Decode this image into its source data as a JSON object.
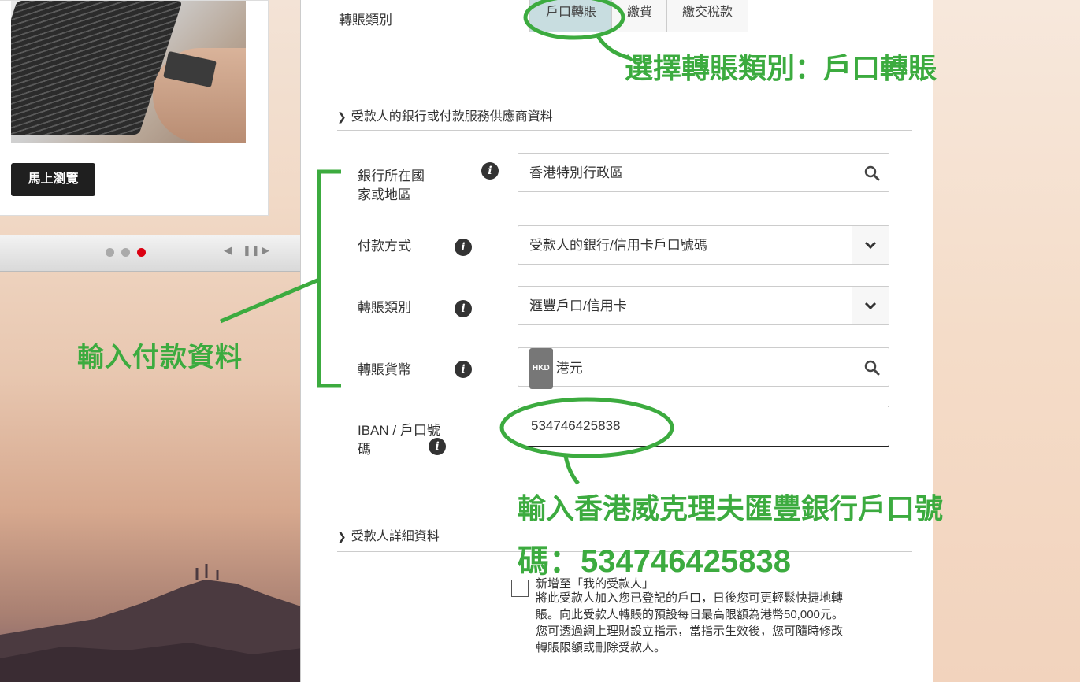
{
  "promo": {
    "browse_button": "馬上瀏覽",
    "carousel_controls": "◀ ⏸ ▶"
  },
  "transfer_type_row": {
    "label": "轉賬類別",
    "tabs": [
      "戶口轉賬",
      "繳費",
      "繳交稅款"
    ],
    "active_tab": "戶口轉賬"
  },
  "bank_section": {
    "header": "受款人的銀行或付款服務供應商資料",
    "fields": {
      "country": {
        "label": "銀行所在國家或地區",
        "label_line1": "銀行所在國",
        "label_line2": "家或地區",
        "value": "香港特別行政區"
      },
      "payment_method": {
        "label": "付款方式",
        "value": "受款人的銀行/信用卡戶口號碼"
      },
      "transfer_type": {
        "label": "轉賬類別",
        "value": "滙豐戶口/信用卡"
      },
      "currency": {
        "label": "轉賬貨幣",
        "badge": "HKD",
        "value": "港元"
      },
      "account": {
        "label": "IBAN / 戶口號碼",
        "label_line1": "IBAN / 戶口號",
        "label_line2": "碼",
        "value": "534746425838"
      }
    }
  },
  "payee_section": {
    "header": "受款人詳細資料",
    "add_to_payees": {
      "title": "新增至「我的受款人」",
      "description": "將此受款人加入您已登記的戶口，日後您可更輕鬆快捷地轉賬。向此受款人轉賬的預設每日最高限額為港幣50,000元。您可透過網上理財設立指示，當指示生效後，您可隨時修改轉賬限額或刪除受款人。"
    }
  },
  "annotations": {
    "select_type": "選擇轉賬類別：戶口轉賬",
    "enter_details": "輸入付款資料",
    "enter_account_line1": "輸入香港威克理夫匯豐銀行戶口號",
    "enter_account_line2": "碼：534746425838"
  },
  "colors": {
    "annotation_green": "#3cab3f",
    "active_dot": "#db0011",
    "active_tab": "#c8dde0"
  },
  "icons": {
    "info": "i",
    "search": "magnifier",
    "dropdown": "chevron-down"
  }
}
